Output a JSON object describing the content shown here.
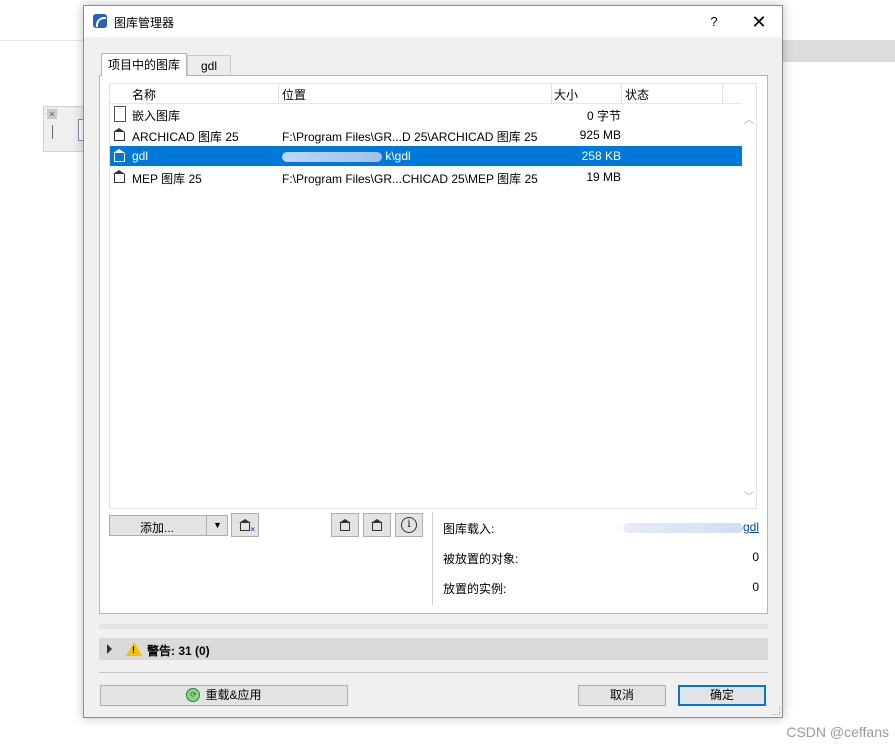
{
  "dialog": {
    "title": "图库管理器",
    "help_label": "?",
    "close_label": "✕"
  },
  "tabs": [
    {
      "label": "项目中的图库",
      "active": true
    },
    {
      "label": "gdl",
      "active": false
    }
  ],
  "table": {
    "headers": {
      "name": "名称",
      "location": "位置",
      "size": "大小",
      "status": "状态"
    },
    "rows": [
      {
        "name": "嵌入图库",
        "location": "",
        "size": "0 字节",
        "status": "",
        "icon": "document-icon",
        "selected": false
      },
      {
        "name": "ARCHICAD 图库 25",
        "location": "F:\\Program Files\\GR...D 25\\ARCHICAD 图库 25",
        "size": "925 MB",
        "status": "",
        "icon": "library-icon",
        "selected": false
      },
      {
        "name": "gdl",
        "location": "k\\gdl",
        "size": "258 KB",
        "status": "",
        "icon": "library-icon",
        "selected": true
      },
      {
        "name": "MEP 图库 25",
        "location": "F:\\Program Files\\GR...CHICAD 25\\MEP 图库 25",
        "size": "19 MB",
        "status": "",
        "icon": "library-icon",
        "selected": false
      }
    ]
  },
  "actions": {
    "add_label": "添加...",
    "info_symbol": "i",
    "badge_x": "×"
  },
  "info": {
    "library_loaded_label": "图库载入:",
    "library_loaded_value": "gdl",
    "placed_objects_label": "被放置的对象:",
    "placed_objects_value": "0",
    "placed_instances_label": "放置的实例:",
    "placed_instances_value": "0"
  },
  "warnings": {
    "label": "警告: 31 (0)",
    "icon_mark": "!"
  },
  "footer": {
    "reload_label": "重载&应用",
    "cancel_label": "取消",
    "ok_label": "确定"
  },
  "watermark": "CSDN @ceffans",
  "colors": {
    "selection": "#0078d7",
    "warning": "#f2c200",
    "link": "#0645ad"
  }
}
